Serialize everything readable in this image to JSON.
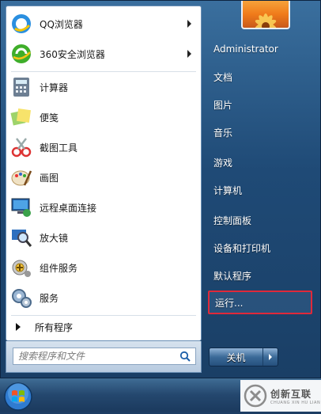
{
  "pinned": [
    {
      "label": "QQ浏览器",
      "icon": "qq-browser-icon",
      "has_submenu": true
    },
    {
      "label": "360安全浏览器",
      "icon": "360-browser-icon",
      "has_submenu": true
    }
  ],
  "recent": [
    {
      "label": "计算器",
      "icon": "calculator-icon"
    },
    {
      "label": "便笺",
      "icon": "sticky-notes-icon"
    },
    {
      "label": "截图工具",
      "icon": "snipping-tool-icon"
    },
    {
      "label": "画图",
      "icon": "paint-icon"
    },
    {
      "label": "远程桌面连接",
      "icon": "remote-desktop-icon"
    },
    {
      "label": "放大镜",
      "icon": "magnifier-icon"
    },
    {
      "label": "组件服务",
      "icon": "component-services-icon"
    },
    {
      "label": "服务",
      "icon": "services-icon"
    }
  ],
  "all_programs": "所有程序",
  "search": {
    "placeholder": "搜索程序和文件"
  },
  "right_pane": {
    "user": "Administrator",
    "items": [
      "文档",
      "图片",
      "音乐",
      "游戏",
      "计算机",
      "控制面板",
      "设备和打印机",
      "默认程序",
      "运行..."
    ],
    "highlighted": "运行..."
  },
  "shutdown": {
    "label": "关机"
  },
  "watermark": {
    "cn": "创新互联",
    "en": "CHUANG XIN HU LIAN"
  },
  "colors": {
    "highlight_border": "#e0293a",
    "menu_blue": "#1f4a76"
  }
}
